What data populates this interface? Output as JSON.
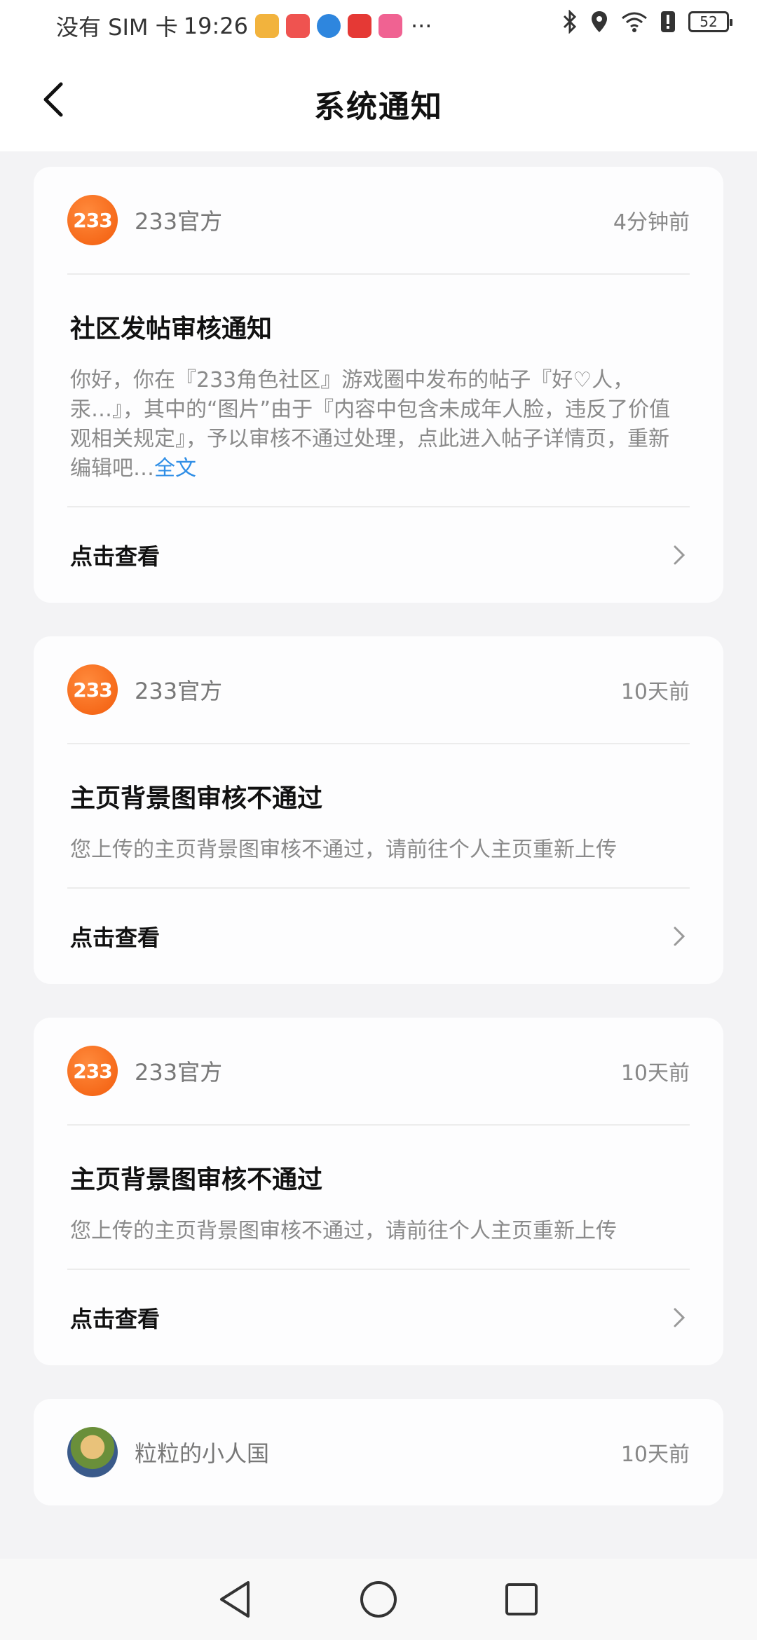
{
  "status": {
    "carrier": "没有 SIM 卡",
    "time": "19:26",
    "more": "···",
    "battery": "52",
    "app_colors": [
      "#f2b33d",
      "#ef5350",
      "#2e86de",
      "#e53935",
      "#f06292"
    ]
  },
  "header": {
    "title": "系统通知",
    "back_icon": "chevron-left-icon"
  },
  "notifications": [
    {
      "sender": "233官方",
      "avatar_text": "233",
      "time": "4分钟前",
      "title": "社区发帖审核通知",
      "text": "你好，你在『233角色社区』游戏圈中发布的帖子『好♡人，汞…』，其中的“图片”由于『内容中包含未成年人脸，违反了价值观相关规定』，予以审核不通过处理，点此进入帖子详情页，重新编辑吧…",
      "more_link": "全文",
      "action": "点击查看"
    },
    {
      "sender": "233官方",
      "avatar_text": "233",
      "time": "10天前",
      "title": "主页背景图审核不通过",
      "text": "您上传的主页背景图审核不通过，请前往个人主页重新上传",
      "action": "点击查看"
    },
    {
      "sender": "233官方",
      "avatar_text": "233",
      "time": "10天前",
      "title": "主页背景图审核不通过",
      "text": "您上传的主页背景图审核不通过，请前往个人主页重新上传",
      "action": "点击查看"
    },
    {
      "sender": "粒粒的小人国",
      "time": "10天前"
    }
  ],
  "nav_icons": [
    "back-triangle-icon",
    "home-circle-icon",
    "recents-square-icon"
  ]
}
